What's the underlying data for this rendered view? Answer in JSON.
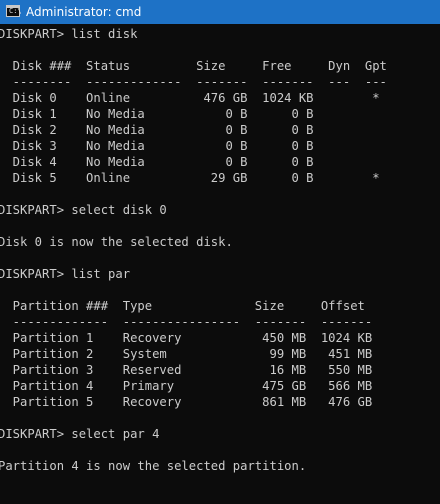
{
  "window": {
    "title": "Administrator: cmd",
    "icon": "cmd-console-icon",
    "icon_glyph": "C:\\"
  },
  "console": {
    "lines": [
      "DISKPART> list disk",
      "",
      "  Disk ###  Status         Size     Free     Dyn  Gpt",
      "  --------  -------------  -------  -------  ---  ---",
      "  Disk 0    Online          476 GB  1024 KB        *",
      "  Disk 1    No Media           0 B      0 B",
      "  Disk 2    No Media           0 B      0 B",
      "  Disk 3    No Media           0 B      0 B",
      "  Disk 4    No Media           0 B      0 B",
      "  Disk 5    Online           29 GB      0 B        *",
      "",
      "DISKPART> select disk 0",
      "",
      "Disk 0 is now the selected disk.",
      "",
      "DISKPART> list par",
      "",
      "  Partition ###  Type              Size     Offset",
      "  -------------  ----------------  -------  -------",
      "  Partition 1    Recovery           450 MB  1024 KB",
      "  Partition 2    System              99 MB   451 MB",
      "  Partition 3    Reserved            16 MB   550 MB",
      "  Partition 4    Primary            475 GB   566 MB",
      "  Partition 5    Recovery           861 MB   476 GB",
      "",
      "DISKPART> select par 4",
      "",
      "Partition 4 is now the selected partition."
    ]
  },
  "colors": {
    "titlebar": "#1e72c6",
    "console_bg": "#0c0c0c",
    "console_text": "#cccccc"
  }
}
